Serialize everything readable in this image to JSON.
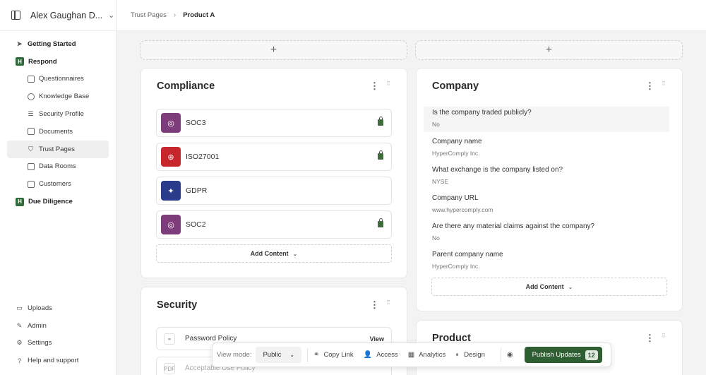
{
  "workspace": {
    "name": "Alex Gaughan D..."
  },
  "sidebar": {
    "items": [
      {
        "label": "Getting Started",
        "icon": "send-icon"
      },
      {
        "label": "Respond",
        "icon": "brand-icon"
      },
      {
        "label": "Questionnaires",
        "icon": "list-icon"
      },
      {
        "label": "Knowledge Base",
        "icon": "info-icon"
      },
      {
        "label": "Security Profile",
        "icon": "database-icon"
      },
      {
        "label": "Documents",
        "icon": "document-icon"
      },
      {
        "label": "Trust Pages",
        "icon": "shield-icon"
      },
      {
        "label": "Data Rooms",
        "icon": "room-icon"
      },
      {
        "label": "Customers",
        "icon": "clipboard-icon"
      },
      {
        "label": "Due Diligence",
        "icon": "brand-icon"
      }
    ],
    "bottom": [
      {
        "label": "Uploads",
        "icon": "folder-icon"
      },
      {
        "label": "Admin",
        "icon": "wrench-icon"
      },
      {
        "label": "Settings",
        "icon": "gear-icon"
      },
      {
        "label": "Help and support",
        "icon": "help-icon"
      }
    ]
  },
  "breadcrumb": {
    "parent": "Trust Pages",
    "current": "Product A"
  },
  "add_section": "+",
  "compliance": {
    "title": "Compliance",
    "items": [
      {
        "label": "SOC3",
        "color": "#7d3c7a",
        "locked": true
      },
      {
        "label": "ISO27001",
        "color": "#c8262d",
        "locked": true
      },
      {
        "label": "GDPR",
        "color": "#2c3c8c",
        "locked": false
      },
      {
        "label": "SOC2",
        "color": "#7d3c7a",
        "locked": true
      }
    ],
    "add_content": "Add Content"
  },
  "company": {
    "title": "Company",
    "qa": [
      {
        "q": "Is the company traded publicly?",
        "a": "No"
      },
      {
        "q": "Company name",
        "a": "HyperComply Inc."
      },
      {
        "q": "What exchange is the company listed on?",
        "a": "NYSE"
      },
      {
        "q": "Company URL",
        "a": "www.hypercomply.com"
      },
      {
        "q": "Are there any material claims against the company?",
        "a": "No"
      },
      {
        "q": "Parent company name",
        "a": "HyperComply Inc."
      }
    ],
    "add_content": "Add Content"
  },
  "security": {
    "title": "Security",
    "policies": [
      {
        "label": "Password Policy",
        "action": "View",
        "icon": "link-icon"
      },
      {
        "label": "Acceptable Use Policy",
        "icon": "pdf-icon",
        "icon_text": "PDF"
      }
    ]
  },
  "product": {
    "title": "Product"
  },
  "toolbar": {
    "view_mode_label": "View mode:",
    "view_mode_value": "Public",
    "copy_link": "Copy Link",
    "access": "Access",
    "analytics": "Analytics",
    "design": "Design",
    "publish": "Publish Updates",
    "publish_count": "12"
  },
  "colors": {
    "accent": "#2f5e33",
    "lock": "#3f6b3f"
  }
}
